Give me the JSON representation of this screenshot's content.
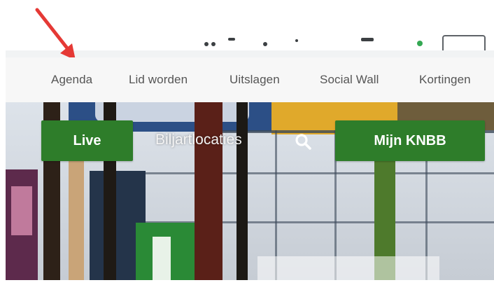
{
  "nav": {
    "items": [
      {
        "label": "Agenda"
      },
      {
        "label": "Lid worden"
      },
      {
        "label": "Uitslagen"
      },
      {
        "label": "Social Wall"
      },
      {
        "label": "Kortingen"
      }
    ]
  },
  "hero": {
    "live_label": "Live",
    "locaties_label": "Biljartlocaties",
    "mijn_label": "Mijn KNBB"
  },
  "icons": {
    "search": "search-icon",
    "annotation": "red-arrow-icon"
  },
  "colors": {
    "accent_green": "#2e7d2a",
    "annotation_red": "#e53935",
    "nav_text": "#555555"
  }
}
